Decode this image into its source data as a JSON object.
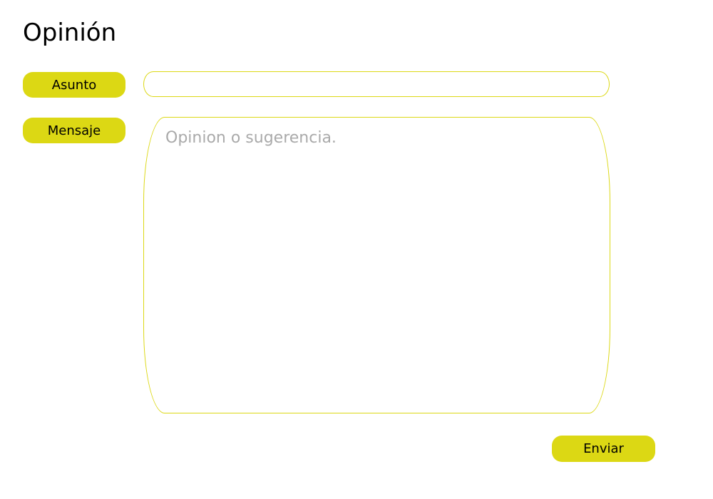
{
  "title": "Opinión",
  "fields": {
    "subject_label": "Asunto",
    "subject_value": "",
    "message_label": "Mensaje",
    "message_placeholder": "Opinion o sugerencia."
  },
  "submit_label": "Enviar",
  "accent": "#dcd814"
}
